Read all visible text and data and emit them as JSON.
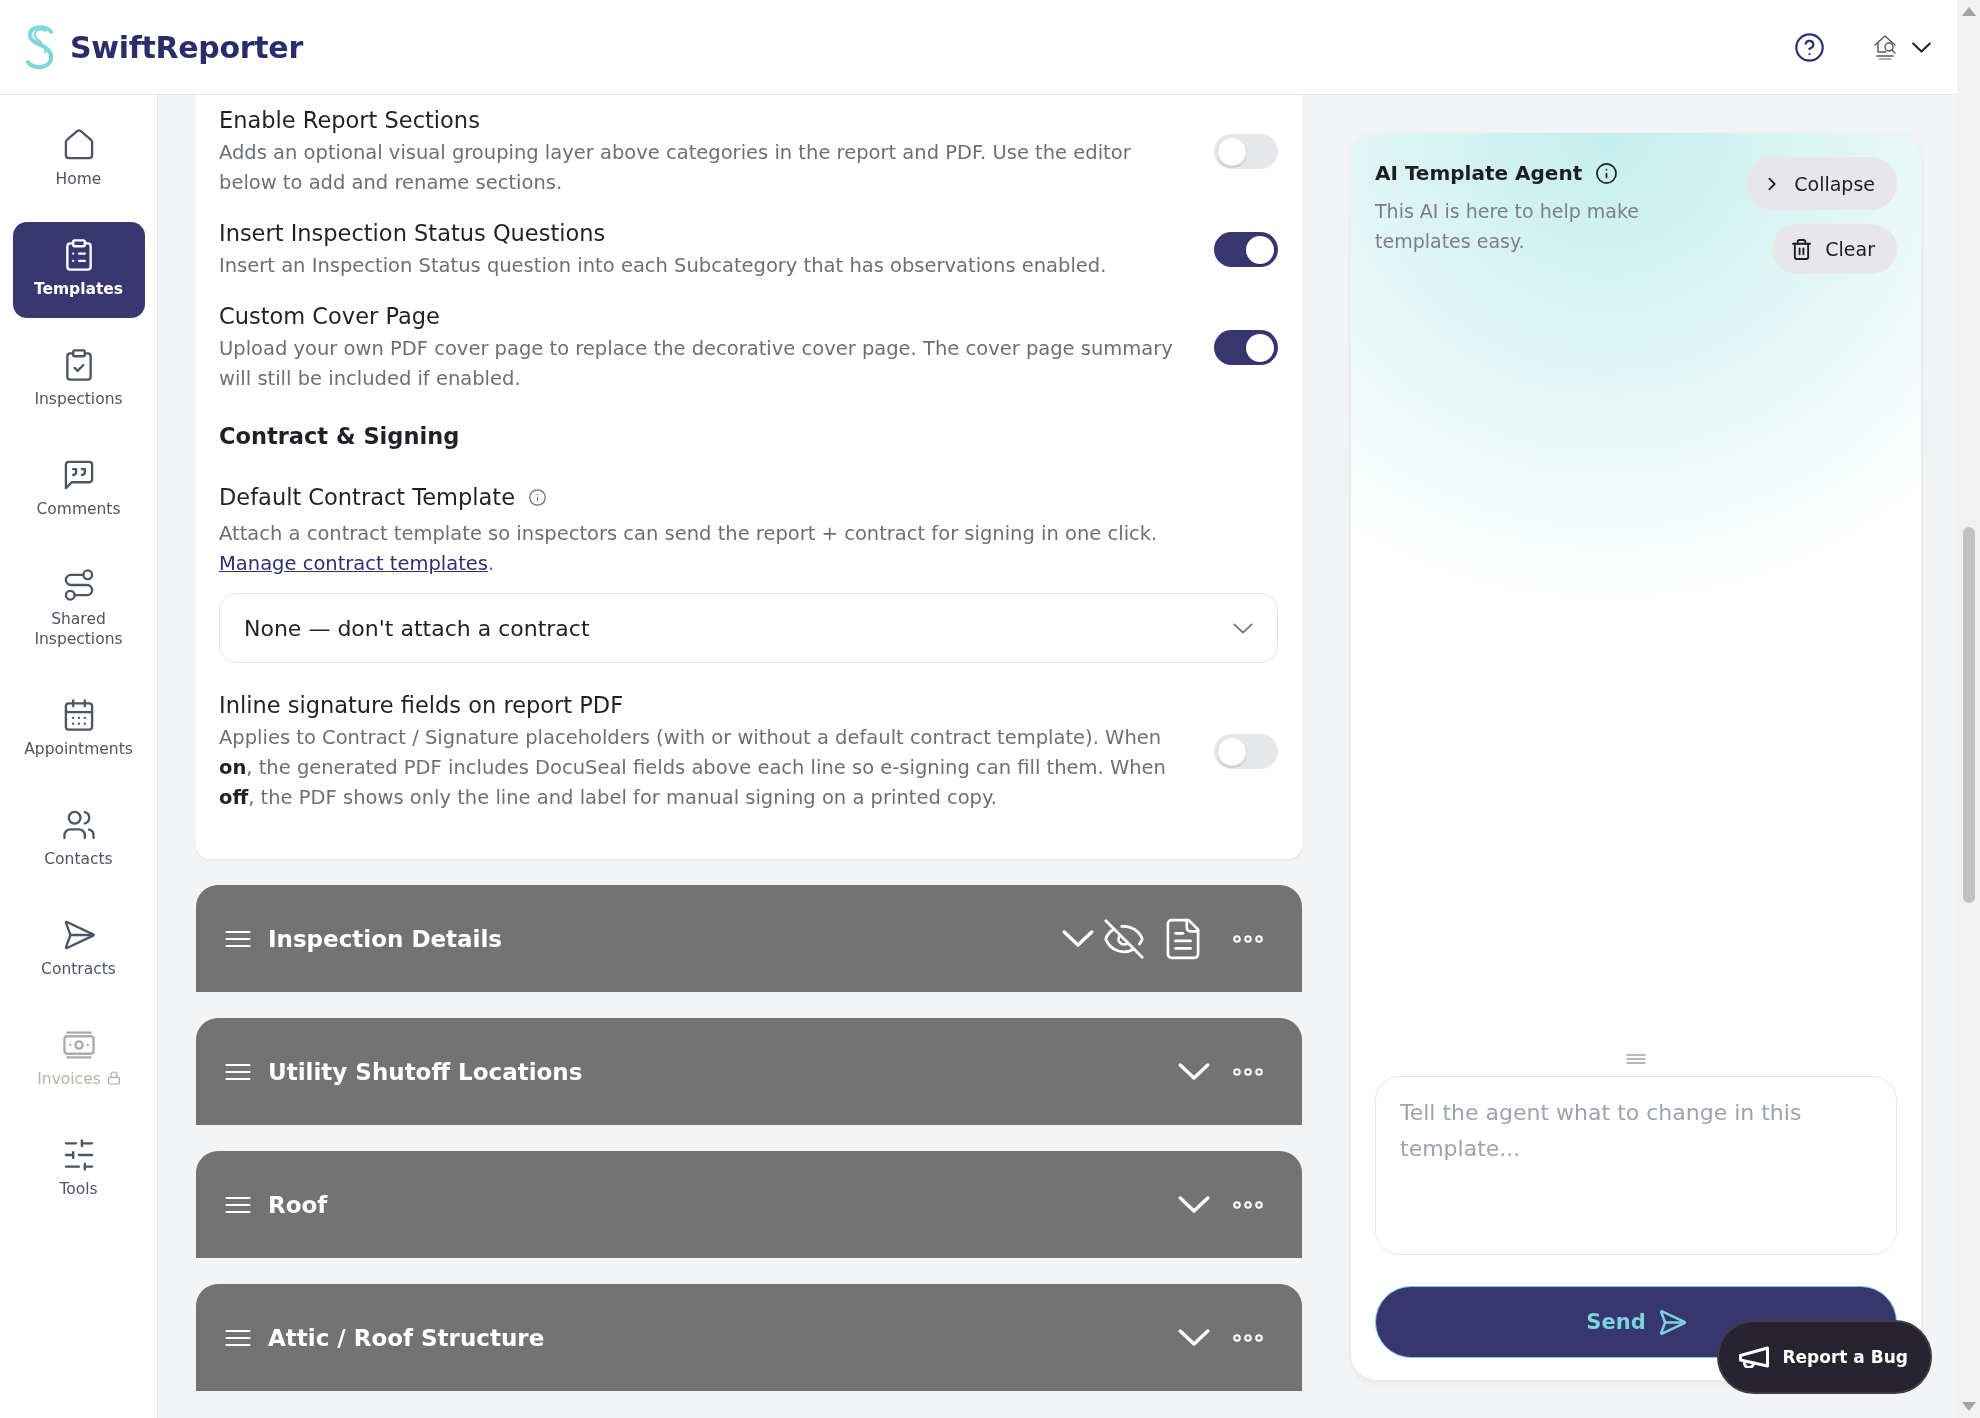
{
  "header": {
    "brand": "SwiftReporter"
  },
  "sidebar": {
    "items": [
      {
        "label": "Home",
        "selected": false,
        "locked": false
      },
      {
        "label": "Templates",
        "selected": true,
        "locked": false
      },
      {
        "label": "Inspections",
        "selected": false,
        "locked": false
      },
      {
        "label": "Comments",
        "selected": false,
        "locked": false
      },
      {
        "label": "Shared Inspections",
        "selected": false,
        "locked": false
      },
      {
        "label": "Appointments",
        "selected": false,
        "locked": false
      },
      {
        "label": "Contacts",
        "selected": false,
        "locked": false
      },
      {
        "label": "Contracts",
        "selected": false,
        "locked": false
      },
      {
        "label": "Invoices",
        "selected": false,
        "locked": true
      },
      {
        "label": "Tools",
        "selected": false,
        "locked": false
      }
    ]
  },
  "settings": [
    {
      "title": "Enable Report Sections",
      "description": "Adds an optional visual grouping layer above categories in the report and PDF. Use the editor below to add and rename sections.",
      "on": false
    },
    {
      "title": "Insert Inspection Status Questions",
      "description": "Insert an Inspection Status question into each Subcategory that has observations enabled.",
      "on": true
    },
    {
      "title": "Custom Cover Page",
      "description": "Upload your own PDF cover page to replace the decorative cover page. The cover page summary will still be included if enabled.",
      "on": true
    }
  ],
  "contract_signing": {
    "heading": "Contract & Signing",
    "default_template": {
      "label": "Default Contract Template",
      "description": "Attach a contract template so inspectors can send the report + contract for signing in one click.",
      "link": "Manage contract templates",
      "link_suffix": ".",
      "value": "None — don't attach a contract"
    },
    "inline_signature": {
      "title": "Inline signature fields on report PDF",
      "description": "Applies to Contract / Signature placeholders (with or without a default contract template). When **on**, the generated PDF includes DocuSeal fields above each line so e-signing can fill them. When **off**, the PDF shows only the line and label for manual signing on a printed copy.",
      "on": false
    }
  },
  "categories": [
    {
      "title": "Inspection Details",
      "hovered": true
    },
    {
      "title": "Utility Shutoff Locations",
      "hovered": false
    },
    {
      "title": "Roof",
      "hovered": false
    },
    {
      "title": "Attic / Roof Structure",
      "hovered": false
    }
  ],
  "agent": {
    "title": "AI Template Agent",
    "subtitle": "This AI is here to help make templates easy.",
    "collapse_button": "Collapse",
    "clear_button": "Clear",
    "input": {
      "placeholder": "Tell the agent what to change in this template..."
    },
    "send_button": "Send"
  },
  "report_bug_button": "Report a Bug"
}
